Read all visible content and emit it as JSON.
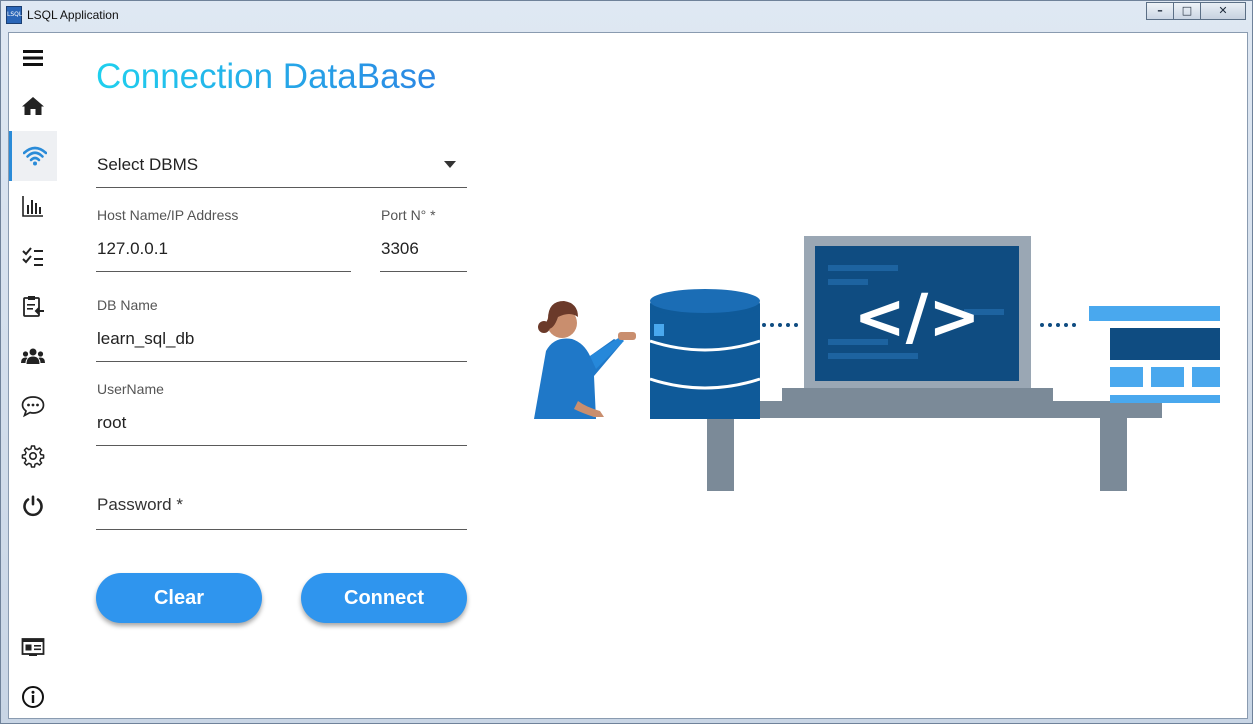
{
  "window": {
    "title": "LSQL Application",
    "icon_text": "LSQL",
    "buttons": [
      "minimize",
      "maximize",
      "close"
    ]
  },
  "sidebar": {
    "items": [
      {
        "icon": "menu-icon",
        "active": false
      },
      {
        "icon": "home-icon",
        "active": false
      },
      {
        "icon": "wifi-icon",
        "active": true
      },
      {
        "icon": "bar-chart-icon",
        "active": false
      },
      {
        "icon": "checklist-icon",
        "active": false
      },
      {
        "icon": "clipboard-icon",
        "active": false
      },
      {
        "icon": "users-icon",
        "active": false
      },
      {
        "icon": "chat-icon",
        "active": false
      },
      {
        "icon": "gear-icon",
        "active": false
      },
      {
        "icon": "power-icon",
        "active": false
      }
    ],
    "bottom_items": [
      {
        "icon": "id-card-icon"
      },
      {
        "icon": "info-icon"
      }
    ]
  },
  "page": {
    "title": "Connection DataBase"
  },
  "form": {
    "dbms": {
      "value": "Select DBMS"
    },
    "host": {
      "label": "Host Name/IP Address",
      "value": "127.0.0.1"
    },
    "port": {
      "label": "Port N° *",
      "value": "3306"
    },
    "db_name": {
      "label": "DB Name",
      "value": "learn_sql_db"
    },
    "username": {
      "label": "UserName",
      "value": "root"
    },
    "password": {
      "label": "Password *",
      "value": ""
    },
    "clear_label": "Clear",
    "connect_label": "Connect"
  },
  "illustration": {
    "code_symbol": "</>"
  },
  "colors": {
    "accent": "#2f95ee",
    "title_gradient_start": "#1fd0ee",
    "title_gradient_end": "#2b86e3",
    "illustration_dark": "#0f4c81",
    "illustration_light": "#49a8ee",
    "table_gray": "#7b8a98"
  }
}
